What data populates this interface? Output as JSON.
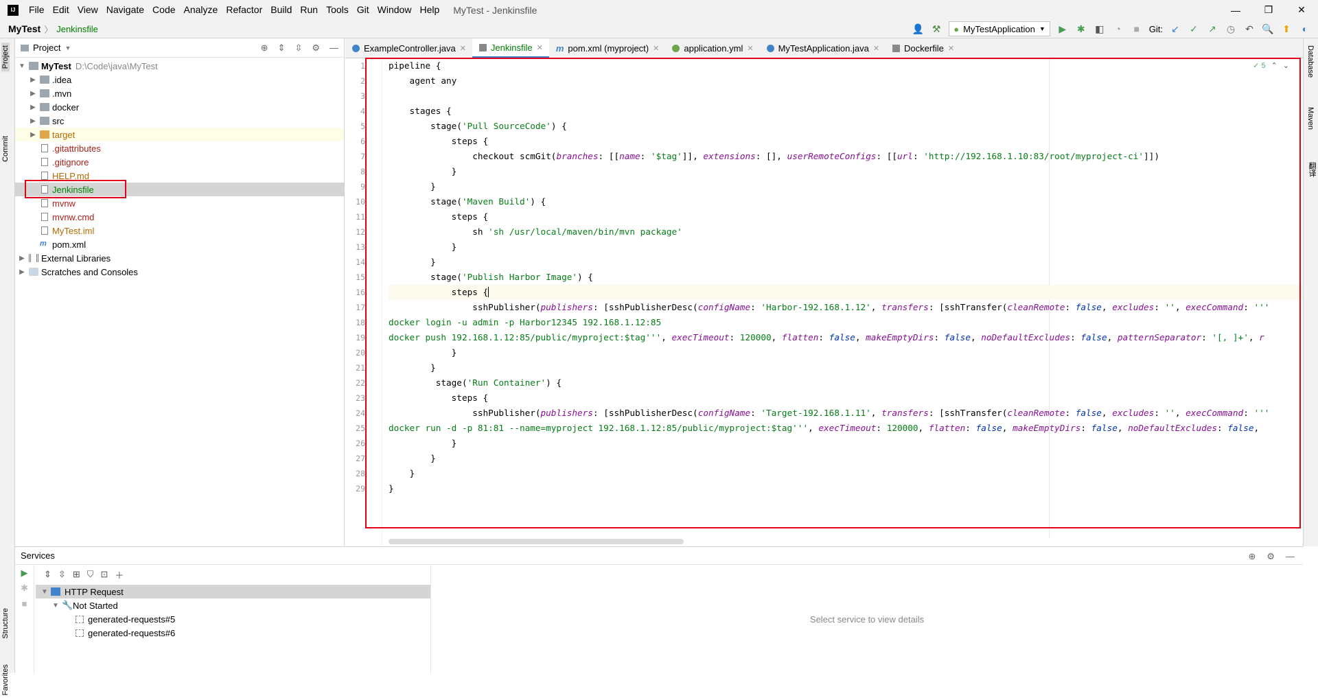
{
  "titlebar": {
    "app_icon": "IJ",
    "menu": [
      "File",
      "Edit",
      "View",
      "Navigate",
      "Code",
      "Analyze",
      "Refactor",
      "Build",
      "Run",
      "Tools",
      "Git",
      "Window",
      "Help"
    ],
    "title": "MyTest - Jenkinsfile",
    "controls": [
      "—",
      "❐",
      "✕"
    ]
  },
  "navbar": {
    "root": "MyTest",
    "sep": "〉",
    "file": "Jenkinsfile",
    "run_config": "MyTestApplication",
    "git_label": "Git:"
  },
  "left_strip": {
    "project": "Project",
    "commit": "Commit",
    "structure": "Structure",
    "favorites": "Favorites"
  },
  "right_strip": {
    "database": "Database",
    "maven": "Maven",
    "extra": "翻译"
  },
  "project": {
    "title": "Project",
    "root_name": "MyTest",
    "root_path": "D:\\Code\\java\\MyTest",
    "items": [
      {
        "name": ".idea",
        "color": "#000000"
      },
      {
        "name": ".mvn",
        "color": "#000000"
      },
      {
        "name": "docker",
        "color": "#000000"
      },
      {
        "name": "src",
        "color": "#000000"
      },
      {
        "name": "target",
        "color": "#b26a00"
      },
      {
        "name": ".gitattributes",
        "color": "#a8201a"
      },
      {
        "name": ".gitignore",
        "color": "#a8201a"
      },
      {
        "name": "HELP.md",
        "color": "#b26a00"
      },
      {
        "name": "Jenkinsfile",
        "color": "#008000"
      },
      {
        "name": "mvnw",
        "color": "#a8201a"
      },
      {
        "name": "mvnw.cmd",
        "color": "#a8201a"
      },
      {
        "name": "MyTest.iml",
        "color": "#b26a00"
      },
      {
        "name": "pom.xml",
        "color": "#000000"
      }
    ],
    "external": "External Libraries",
    "scratches": "Scratches and Consoles"
  },
  "tabs": [
    {
      "label": "ExampleController.java",
      "icon_color": "#4083c9"
    },
    {
      "label": "Jenkinsfile",
      "icon_color": "#888888"
    },
    {
      "label": "pom.xml (myproject)",
      "icon_color": "#4083c9"
    },
    {
      "label": "application.yml",
      "icon_color": "#6ea64a"
    },
    {
      "label": "MyTestApplication.java",
      "icon_color": "#4083c9"
    },
    {
      "label": "Dockerfile",
      "icon_color": "#888888"
    }
  ],
  "editor": {
    "inspection": "✓ 5",
    "line_numbers": [
      "1",
      "2",
      "3",
      "4",
      "5",
      "6",
      "7",
      "8",
      "9",
      "10",
      "11",
      "12",
      "13",
      "14",
      "15",
      "16",
      "17",
      "18",
      "19",
      "20",
      "21",
      "22",
      "23",
      "24",
      "25",
      "26",
      "27",
      "28",
      "29"
    ]
  },
  "services": {
    "title": "Services",
    "root": "HTTP Request",
    "group": "Not Started",
    "items": [
      "generated-requests#5",
      "generated-requests#6"
    ],
    "detail": "Select service to view details"
  }
}
